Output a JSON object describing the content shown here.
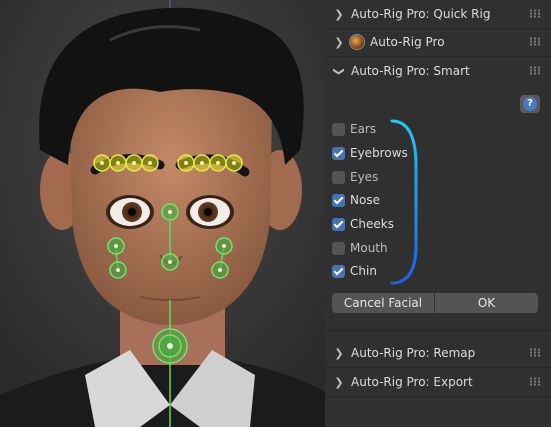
{
  "panel": {
    "headers": {
      "quick_rig": "Auto-Rig Pro: Quick Rig",
      "auto_rig_pro": "Auto-Rig Pro",
      "smart": "Auto-Rig Pro: Smart",
      "remap": "Auto-Rig Pro: Remap",
      "export": "Auto-Rig Pro: Export"
    },
    "help_label": "?",
    "options": [
      {
        "label": "Ears",
        "checked": false
      },
      {
        "label": "Eyebrows",
        "checked": true
      },
      {
        "label": "Eyes",
        "checked": false
      },
      {
        "label": "Nose",
        "checked": true
      },
      {
        "label": "Cheeks",
        "checked": true
      },
      {
        "label": "Mouth",
        "checked": false
      },
      {
        "label": "Chin",
        "checked": true
      }
    ],
    "buttons": {
      "cancel": "Cancel Facial",
      "ok": "OK"
    }
  },
  "icons": {
    "expanded": "chevron-down-icon",
    "collapsed": "chevron-right-icon",
    "drag": "drag-grip-icon",
    "help": "help-icon",
    "addon": "auto-rig-pro-logo-icon"
  },
  "colors": {
    "panel_bg": "#303030",
    "checkbox_on": "#4772b3",
    "marker": "#d9d820",
    "rig_line": "#5ddc5d",
    "bracket": "#1f8cf0"
  }
}
